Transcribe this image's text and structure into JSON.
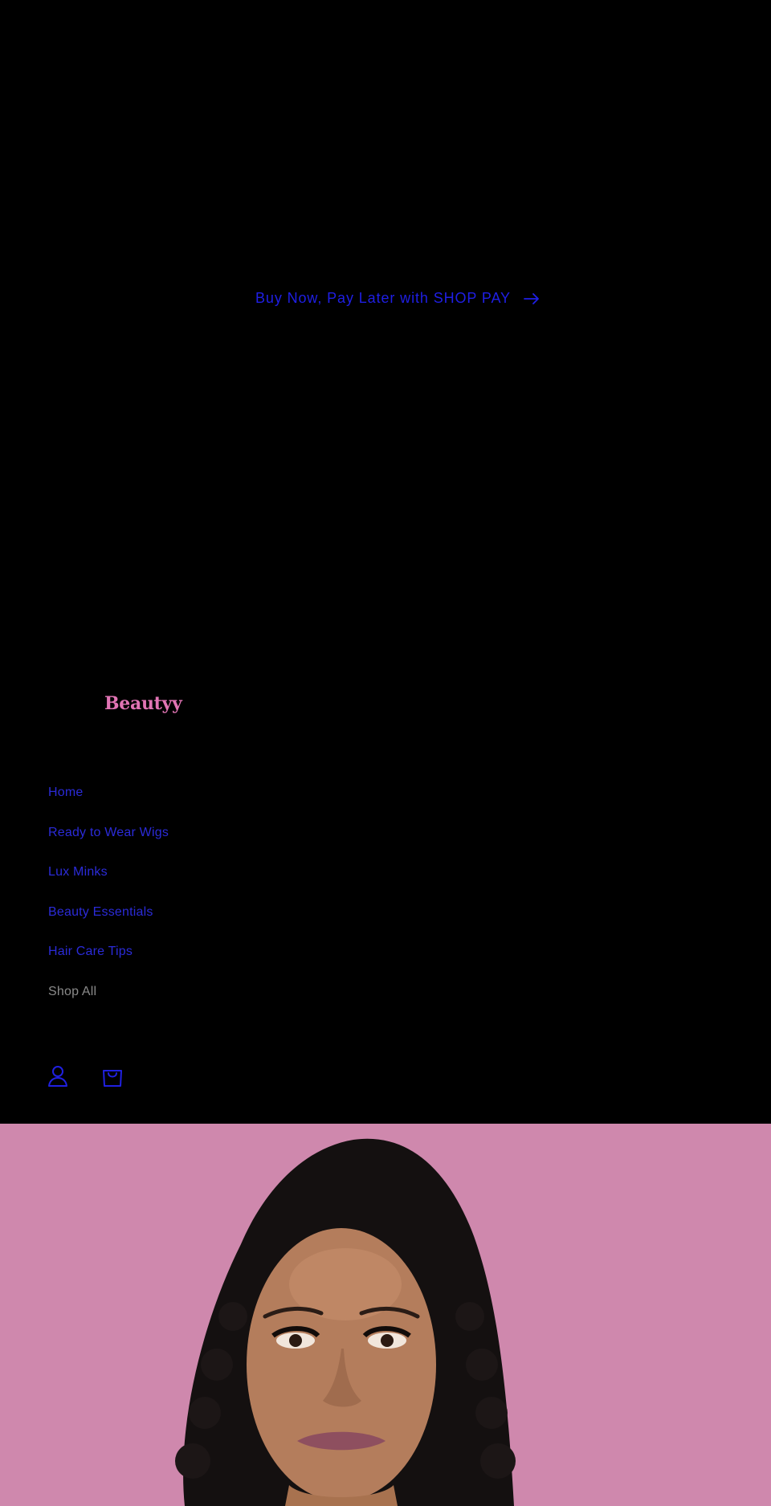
{
  "announcement": {
    "text": "Buy Now, Pay Later with SHOP PAY",
    "arrow_icon": "arrow-right-icon"
  },
  "header": {
    "logo_text": "Beautyy",
    "nav": [
      {
        "label": "Home"
      },
      {
        "label": "Ready to Wear Wigs"
      },
      {
        "label": "Lux Minks"
      },
      {
        "label": "Beauty Essentials"
      },
      {
        "label": "Hair Care Tips"
      },
      {
        "label": "Shop All"
      }
    ],
    "icons": [
      "account-icon",
      "cart-icon"
    ]
  },
  "hero": {
    "image": "portrait-woman-curly-wig-image"
  },
  "colors": {
    "background": "#000000",
    "link": "#2b2bd8",
    "logo": "#e174b4",
    "hero_bg": "#cf88ad"
  }
}
